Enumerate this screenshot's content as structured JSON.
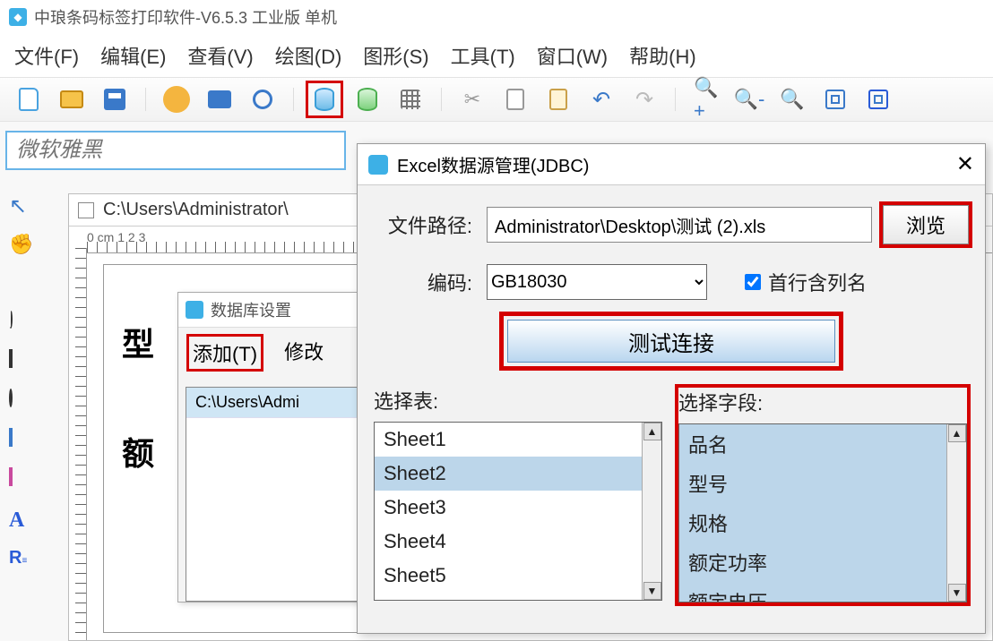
{
  "app": {
    "title": "中琅条码标签打印软件-V6.5.3 工业版 单机"
  },
  "menu": {
    "file": "文件(F)",
    "edit": "编辑(E)",
    "view": "查看(V)",
    "draw": "绘图(D)",
    "shape": "图形(S)",
    "tool": "工具(T)",
    "window": "窗口(W)",
    "help": "帮助(H)"
  },
  "fontfield": {
    "placeholder": "微软雅黑"
  },
  "doc": {
    "path": "C:\\Users\\Administrator\\",
    "ruler_h": "0 cm  1        2        3",
    "text1": "型",
    "text2": "额"
  },
  "dbset": {
    "title": "数据库设置",
    "add": "添加(T)",
    "modify": "修改",
    "row1": "C:\\Users\\Admi"
  },
  "excel": {
    "title": "Excel数据源管理(JDBC)",
    "close": "✕",
    "path_label": "文件路径:",
    "path_value": "Administrator\\Desktop\\测试 (2).xls",
    "browse": "浏览",
    "enc_label": "编码:",
    "enc_value": "GB18030",
    "header_checkbox": "首行含列名",
    "test_btn": "测试连接",
    "select_table": "选择表:",
    "select_field": "选择字段:",
    "tables": [
      "Sheet1",
      "Sheet2",
      "Sheet3",
      "Sheet4",
      "Sheet5"
    ],
    "tables_selected_index": 1,
    "fields": [
      "品名",
      "型号",
      "规格",
      "额定功率",
      "额定电压"
    ]
  }
}
